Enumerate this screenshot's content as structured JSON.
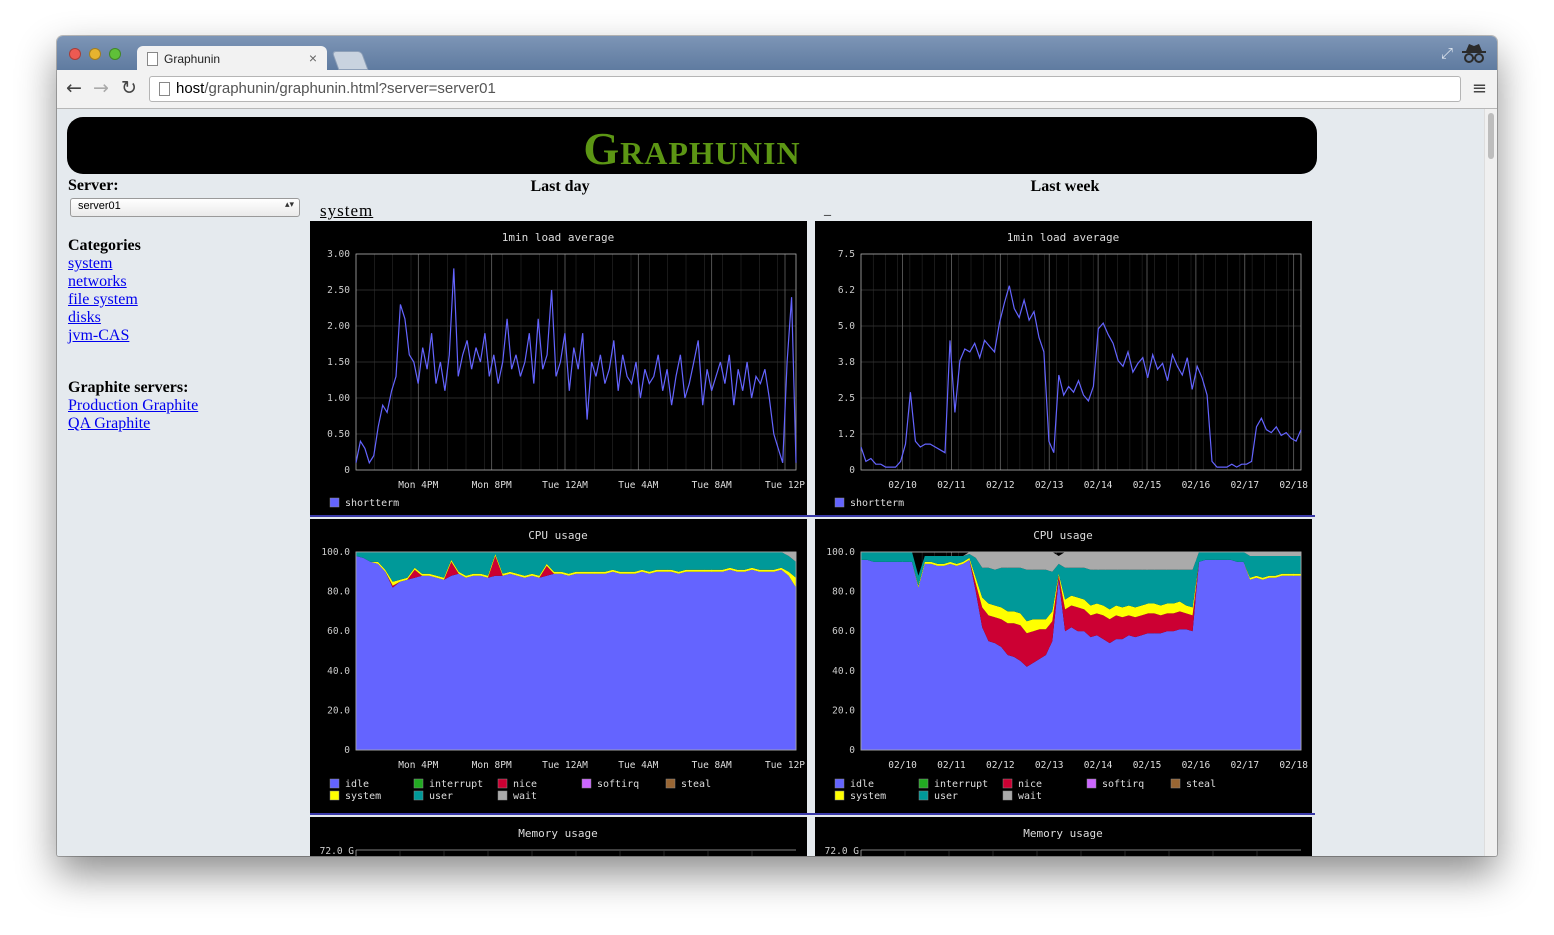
{
  "browser": {
    "tab_title": "Graphunin",
    "tab_close": "×",
    "url_host": "host",
    "url_path": "/graphunin/graphunin.html?server=server01",
    "nav_back": "←",
    "nav_forward": "→",
    "nav_reload": "↻",
    "menu": "≡",
    "fullscreen": "⤢"
  },
  "page": {
    "title": "Graphunin",
    "server_label": "Server:",
    "server_selected": "server01",
    "categories_heading": "Categories",
    "categories": [
      "system",
      "networks",
      "file system",
      "disks",
      "jvm-CAS"
    ],
    "graphite_heading": "Graphite servers:",
    "graphite_servers": [
      "Production Graphite",
      "QA Graphite"
    ],
    "col_last_day": "Last day",
    "col_last_week": "Last week",
    "section_link": "system",
    "section_dash": "_"
  },
  "colors": {
    "title_green": "#5c9614",
    "link_blue": "#0000ee",
    "series_blue": "#6464ff",
    "idle": "#6464ff",
    "interrupt": "#22aa22",
    "nice": "#cc0033",
    "softirq": "#cc66ff",
    "steal": "#996633",
    "system": "#ffff00",
    "user": "#009999",
    "wait": "#aaaaaa"
  },
  "chart_data": [
    {
      "id": "load-day",
      "type": "line",
      "title": "1min load average",
      "xticks": [
        "Mon  4PM",
        "Mon  8PM",
        "Tue 12AM",
        "Tue  4AM",
        "Tue  8AM",
        "Tue 12P"
      ],
      "yticks": [
        "3.00",
        "2.50",
        "2.00",
        "1.50",
        "1.00",
        "0.50",
        "0"
      ],
      "ylim": [
        0,
        3
      ],
      "legend": [
        {
          "name": "shortterm",
          "color": "#6464ff"
        }
      ],
      "series": [
        {
          "name": "shortterm",
          "color": "#6464ff",
          "values": [
            0.1,
            0.4,
            0.3,
            0.1,
            0.2,
            0.6,
            0.9,
            0.8,
            1.1,
            1.3,
            2.3,
            2.1,
            1.6,
            1.5,
            1.2,
            1.7,
            1.4,
            1.9,
            1.2,
            1.5,
            1.1,
            1.6,
            2.8,
            1.3,
            1.6,
            1.8,
            1.4,
            1.7,
            1.5,
            1.9,
            1.3,
            1.6,
            1.2,
            1.5,
            2.1,
            1.4,
            1.6,
            1.3,
            1.5,
            1.9,
            1.2,
            2.1,
            1.4,
            1.6,
            2.5,
            1.3,
            1.5,
            1.9,
            1.1,
            1.7,
            1.4,
            1.9,
            0.7,
            1.5,
            1.3,
            1.6,
            1.2,
            1.4,
            1.8,
            1.1,
            1.6,
            1.3,
            1.2,
            1.5,
            1.0,
            1.4,
            1.2,
            1.3,
            1.6,
            1.1,
            1.4,
            0.9,
            1.3,
            1.6,
            1.0,
            1.2,
            1.5,
            1.8,
            0.9,
            1.4,
            1.1,
            1.3,
            1.5,
            1.2,
            1.6,
            0.9,
            1.4,
            1.1,
            1.5,
            1.0,
            1.3,
            1.2,
            1.4,
            1.0,
            0.5,
            0.3,
            0.1,
            1.5,
            2.4,
            0.1
          ]
        }
      ]
    },
    {
      "id": "load-week",
      "type": "line",
      "title": "1min load average",
      "xticks": [
        "02/10",
        "02/11",
        "02/12",
        "02/13",
        "02/14",
        "02/15",
        "02/16",
        "02/17",
        "02/18"
      ],
      "yticks": [
        "7.5",
        "6.2",
        "5.0",
        "3.8",
        "2.5",
        "1.2",
        "0"
      ],
      "ylim": [
        0,
        7.5
      ],
      "legend": [
        {
          "name": "shortterm",
          "color": "#6464ff"
        }
      ],
      "series": [
        {
          "name": "shortterm",
          "color": "#6464ff",
          "values": [
            0.8,
            0.3,
            0.4,
            0.2,
            0.2,
            0.1,
            0.1,
            0.1,
            0.3,
            0.9,
            2.7,
            1.0,
            0.8,
            0.9,
            0.9,
            0.8,
            0.7,
            0.6,
            4.5,
            2.0,
            3.8,
            4.2,
            4.1,
            4.4,
            3.9,
            4.5,
            4.3,
            4.1,
            5.1,
            5.8,
            6.4,
            5.6,
            5.3,
            5.9,
            5.2,
            5.5,
            4.6,
            4.1,
            1.0,
            0.6,
            3.3,
            2.6,
            2.9,
            2.7,
            3.1,
            2.6,
            2.4,
            2.9,
            4.9,
            5.1,
            4.7,
            4.4,
            3.8,
            3.6,
            4.1,
            3.4,
            3.7,
            3.9,
            3.2,
            4.0,
            3.5,
            3.7,
            3.1,
            4.0,
            3.6,
            3.3,
            3.9,
            2.8,
            3.6,
            3.2,
            2.6,
            0.3,
            0.1,
            0.1,
            0.1,
            0.2,
            0.1,
            0.2,
            0.2,
            0.3,
            1.5,
            1.8,
            1.4,
            1.3,
            1.5,
            1.2,
            1.3,
            1.1,
            1.0,
            1.4
          ]
        }
      ]
    },
    {
      "id": "cpu-day",
      "type": "area",
      "title": "CPU usage",
      "xticks": [
        "Mon  4PM",
        "Mon  8PM",
        "Tue 12AM",
        "Tue  4AM",
        "Tue  8AM",
        "Tue 12P"
      ],
      "yticks": [
        "100.0",
        "80.0",
        "60.0",
        "40.0",
        "20.0",
        "0"
      ],
      "ylim": [
        0,
        100
      ],
      "legend": [
        {
          "name": "idle",
          "color": "#6464ff"
        },
        {
          "name": "interrupt",
          "color": "#22aa22"
        },
        {
          "name": "nice",
          "color": "#cc0033"
        },
        {
          "name": "softirq",
          "color": "#cc66ff"
        },
        {
          "name": "steal",
          "color": "#996633"
        },
        {
          "name": "system",
          "color": "#ffff00"
        },
        {
          "name": "user",
          "color": "#009999"
        },
        {
          "name": "wait",
          "color": "#aaaaaa"
        }
      ],
      "stack": {
        "idle": [
          98,
          97,
          95,
          94,
          90,
          82,
          85,
          86,
          87,
          88,
          88,
          87,
          86,
          88,
          89,
          87,
          88,
          88,
          87,
          88,
          88,
          89,
          88,
          87,
          88,
          87,
          88,
          89,
          89,
          88,
          89,
          89,
          89,
          89,
          89,
          90,
          89,
          89,
          89,
          90,
          89,
          90,
          90,
          90,
          89,
          90,
          90,
          90,
          90,
          90,
          90,
          91,
          90,
          90,
          91,
          90,
          90,
          90,
          91,
          88,
          82
        ],
        "nice": [
          0,
          0,
          0,
          0,
          0,
          1,
          0,
          0,
          4,
          0,
          0,
          0,
          0,
          7,
          0,
          0,
          0,
          0,
          0,
          10,
          0,
          0,
          0,
          0,
          0,
          0,
          5,
          0,
          0,
          0,
          0,
          0,
          0,
          0,
          0,
          0,
          0,
          0,
          0,
          0,
          0,
          0,
          0,
          0,
          0,
          0,
          0,
          0,
          0,
          0,
          0,
          0,
          0,
          0,
          0,
          0,
          0,
          0,
          0,
          0,
          0
        ],
        "system": [
          0,
          0,
          0,
          1,
          1,
          2,
          1,
          1,
          1,
          1,
          1,
          1,
          1,
          1,
          1,
          1,
          1,
          1,
          1,
          1,
          1,
          1,
          1,
          1,
          1,
          1,
          1,
          1,
          1,
          1,
          1,
          1,
          1,
          1,
          1,
          1,
          1,
          1,
          1,
          1,
          1,
          1,
          1,
          1,
          1,
          1,
          1,
          1,
          1,
          1,
          1,
          1,
          1,
          1,
          1,
          1,
          1,
          1,
          1,
          2,
          5
        ],
        "user": [
          2,
          3,
          5,
          5,
          9,
          15,
          14,
          13,
          8,
          11,
          11,
          12,
          13,
          4,
          10,
          12,
          11,
          11,
          12,
          1,
          11,
          10,
          11,
          12,
          11,
          12,
          6,
          10,
          10,
          11,
          10,
          10,
          10,
          10,
          10,
          9,
          10,
          10,
          10,
          9,
          10,
          9,
          9,
          9,
          10,
          9,
          9,
          9,
          9,
          9,
          9,
          8,
          9,
          9,
          8,
          9,
          9,
          9,
          8,
          8,
          8
        ],
        "wait": [
          0,
          0,
          0,
          0,
          0,
          0,
          0,
          0,
          0,
          0,
          0,
          0,
          0,
          0,
          0,
          0,
          0,
          0,
          0,
          0,
          0,
          0,
          0,
          0,
          0,
          0,
          0,
          0,
          0,
          0,
          0,
          0,
          0,
          0,
          0,
          0,
          0,
          0,
          0,
          0,
          0,
          0,
          0,
          0,
          0,
          0,
          0,
          0,
          0,
          0,
          0,
          0,
          0,
          0,
          0,
          0,
          0,
          0,
          0,
          2,
          5
        ]
      }
    },
    {
      "id": "cpu-week",
      "type": "area",
      "title": "CPU usage",
      "xticks": [
        "02/10",
        "02/11",
        "02/12",
        "02/13",
        "02/14",
        "02/15",
        "02/16",
        "02/17",
        "02/18"
      ],
      "yticks": [
        "100.0",
        "80.0",
        "60.0",
        "40.0",
        "20.0",
        "0"
      ],
      "ylim": [
        0,
        100
      ],
      "legend": [
        {
          "name": "idle",
          "color": "#6464ff"
        },
        {
          "name": "interrupt",
          "color": "#22aa22"
        },
        {
          "name": "nice",
          "color": "#cc0033"
        },
        {
          "name": "softirq",
          "color": "#cc66ff"
        },
        {
          "name": "steal",
          "color": "#996633"
        },
        {
          "name": "system",
          "color": "#ffff00"
        },
        {
          "name": "user",
          "color": "#009999"
        },
        {
          "name": "wait",
          "color": "#aaaaaa"
        }
      ],
      "stack": {
        "idle": [
          96,
          96,
          95,
          95,
          95,
          95,
          95,
          95,
          95,
          82,
          94,
          94,
          93,
          93,
          94,
          93,
          94,
          96,
          80,
          62,
          55,
          54,
          52,
          48,
          47,
          45,
          42,
          44,
          46,
          48,
          55,
          86,
          60,
          62,
          60,
          60,
          57,
          58,
          56,
          54,
          56,
          56,
          58,
          57,
          58,
          59,
          59,
          59,
          60,
          60,
          61,
          61,
          60,
          95,
          96,
          96,
          96,
          96,
          96,
          95,
          95,
          86,
          87,
          86,
          87,
          87,
          88,
          88,
          88,
          88
        ],
        "nice": [
          0,
          0,
          0,
          0,
          0,
          0,
          0,
          0,
          0,
          0,
          0,
          0,
          0,
          0,
          0,
          0,
          0,
          0,
          4,
          10,
          13,
          13,
          14,
          16,
          17,
          18,
          17,
          16,
          15,
          13,
          10,
          2,
          11,
          11,
          12,
          11,
          11,
          11,
          12,
          12,
          12,
          11,
          10,
          10,
          10,
          10,
          10,
          9,
          9,
          9,
          9,
          8,
          8,
          0,
          0,
          0,
          0,
          0,
          0,
          0,
          0,
          0,
          0,
          0,
          0,
          0,
          0,
          0,
          0,
          0
        ],
        "system": [
          0,
          0,
          0,
          0,
          0,
          0,
          0,
          0,
          0,
          1,
          1,
          1,
          1,
          1,
          1,
          1,
          1,
          1,
          3,
          5,
          6,
          6,
          6,
          6,
          6,
          6,
          6,
          6,
          5,
          5,
          5,
          1,
          5,
          5,
          5,
          5,
          5,
          5,
          5,
          5,
          5,
          5,
          5,
          5,
          5,
          5,
          5,
          5,
          5,
          5,
          5,
          4,
          4,
          0,
          0,
          0,
          0,
          0,
          0,
          0,
          0,
          1,
          1,
          1,
          1,
          1,
          1,
          1,
          1,
          1
        ],
        "user": [
          4,
          4,
          5,
          5,
          5,
          5,
          5,
          5,
          5,
          5,
          3,
          3,
          4,
          4,
          3,
          4,
          3,
          2,
          10,
          15,
          18,
          18,
          20,
          22,
          22,
          23,
          26,
          25,
          25,
          25,
          20,
          5,
          16,
          14,
          15,
          16,
          18,
          17,
          18,
          20,
          18,
          19,
          18,
          19,
          18,
          17,
          17,
          18,
          17,
          17,
          16,
          18,
          19,
          5,
          4,
          4,
          4,
          4,
          4,
          5,
          5,
          11,
          10,
          11,
          10,
          10,
          9,
          9,
          9,
          9
        ],
        "wait": [
          0,
          0,
          0,
          0,
          0,
          0,
          0,
          0,
          0,
          0,
          0,
          0,
          0,
          0,
          0,
          0,
          0,
          1,
          3,
          8,
          8,
          9,
          8,
          8,
          8,
          8,
          9,
          9,
          9,
          9,
          10,
          4,
          8,
          8,
          8,
          8,
          9,
          9,
          9,
          9,
          9,
          9,
          9,
          9,
          9,
          9,
          9,
          9,
          9,
          9,
          9,
          9,
          9,
          0,
          0,
          0,
          0,
          0,
          0,
          0,
          0,
          2,
          2,
          2,
          2,
          2,
          2,
          2,
          2,
          2
        ]
      }
    },
    {
      "id": "mem-day",
      "type": "area",
      "title": "Memory usage",
      "yticks": [
        "72.0 G"
      ]
    },
    {
      "id": "mem-week",
      "type": "area",
      "title": "Memory usage",
      "yticks": [
        "72.0 G"
      ]
    }
  ]
}
